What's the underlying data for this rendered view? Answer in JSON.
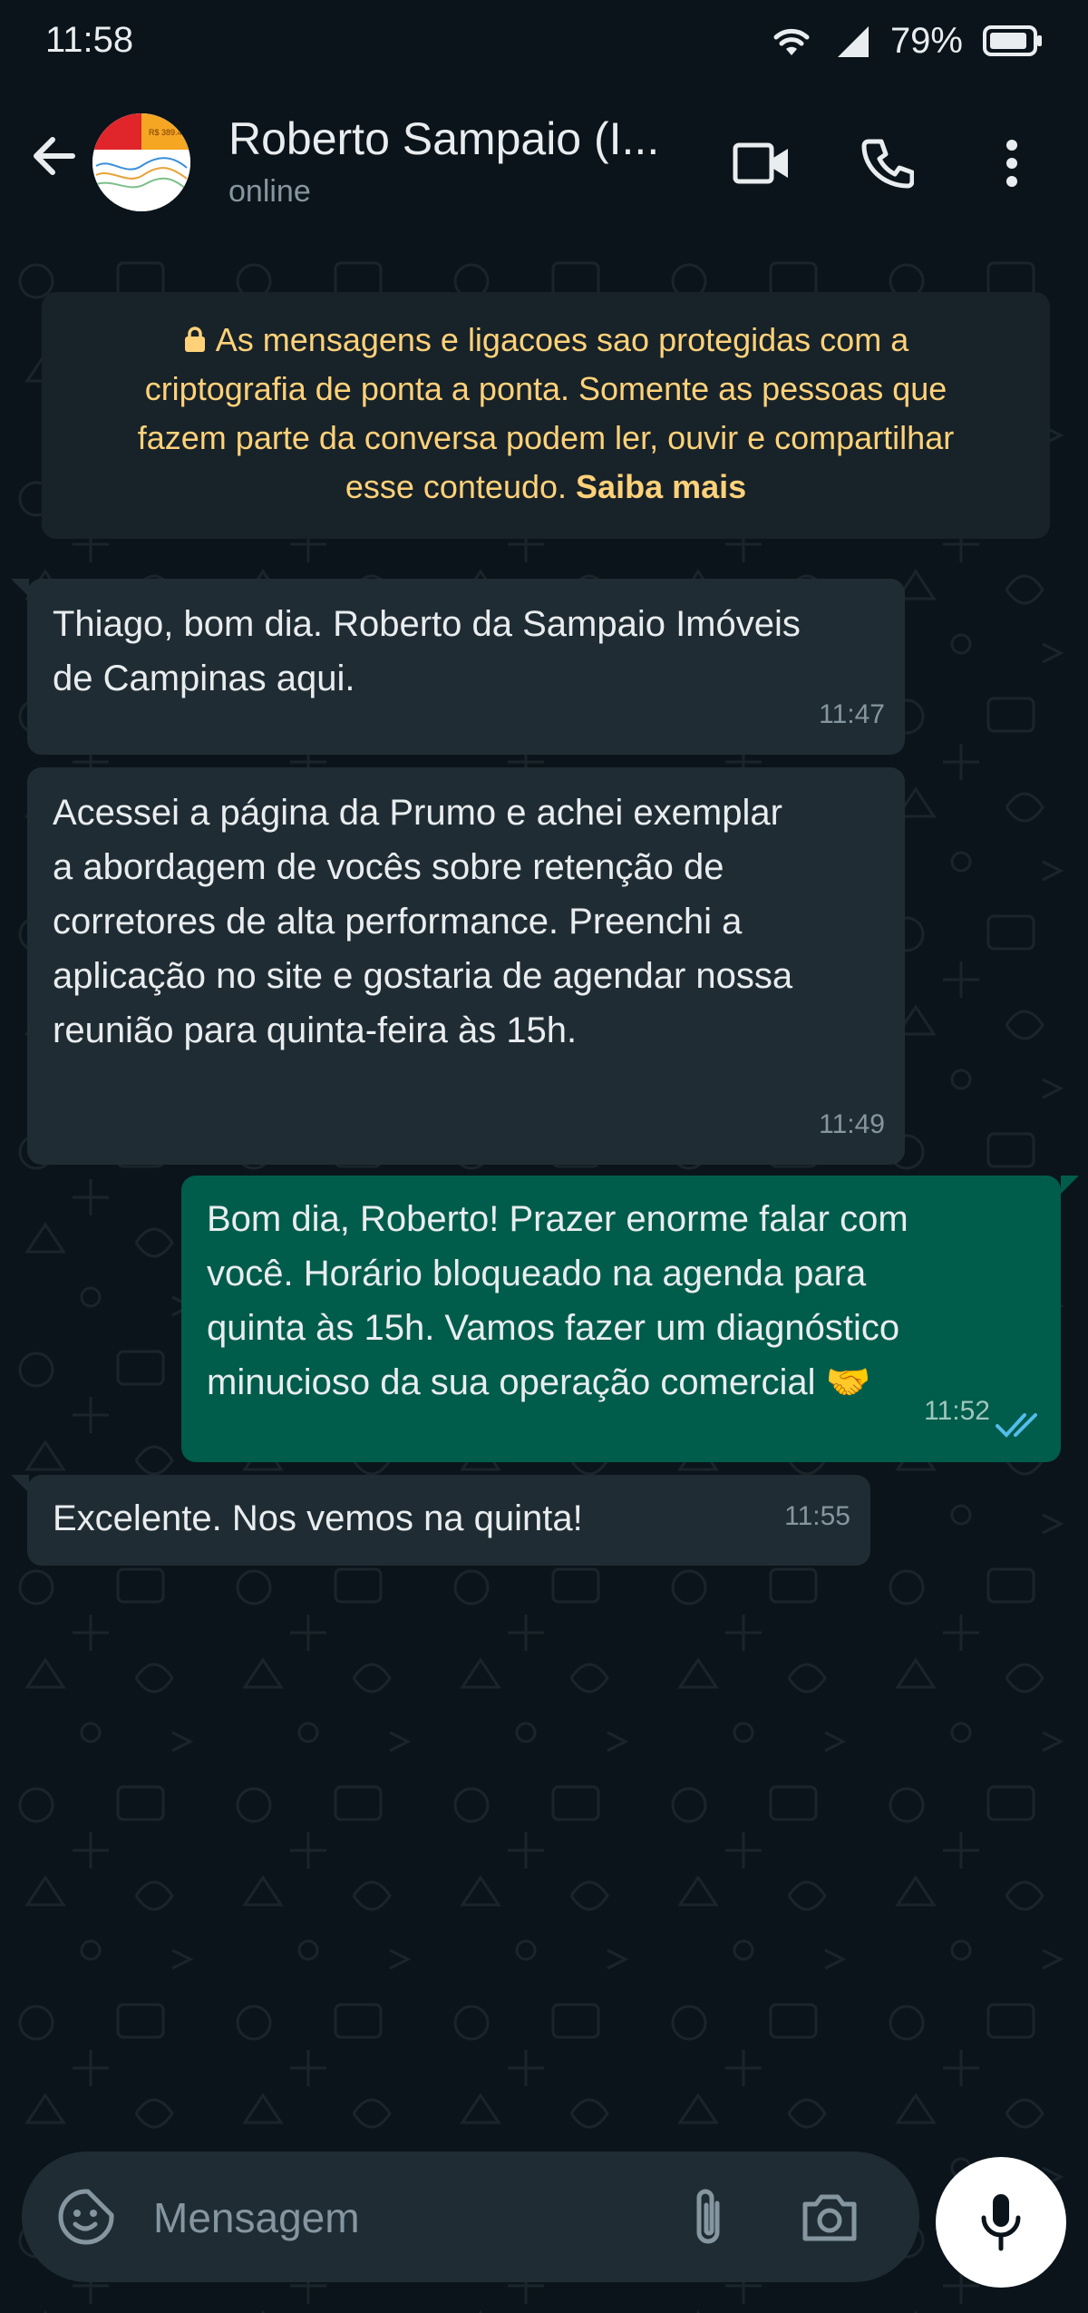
{
  "status_bar": {
    "time": "11:58",
    "battery": "79%"
  },
  "header": {
    "contact_name": "Roberto Sampaio (I...",
    "contact_status": "online",
    "avatar_text": "R$ 389.4..."
  },
  "encryption": {
    "line1": "As mensagens e ligacoes sao protegidas com a",
    "line2": "criptografia de ponta a ponta. Somente as pessoas que",
    "line3": "fazem parte da conversa podem ler, ouvir e compartilhar",
    "line4_prefix": "esse conteudo.",
    "link": "Saiba mais"
  },
  "messages": [
    {
      "direction": "in",
      "text": "Thiago, bom dia. Roberto da Sampaio Imóveis\nde Campinas aqui.",
      "time": "11:47"
    },
    {
      "direction": "in",
      "text": "Acessei a página da Prumo e achei exemplar\na abordagem de vocês sobre retenção de\ncorretores de alta performance. Preenchi a\naplicação no site e gostaria de agendar nossa\nreunião para quinta-feira às 15h.",
      "time": "11:49"
    },
    {
      "direction": "out",
      "text": "Bom dia, Roberto! Prazer enorme falar com\nvocê. Horário bloqueado na agenda para\nquinta às 15h. Vamos fazer um diagnóstico\nminucioso da sua operação comercial 🤝",
      "time": "11:52",
      "status": "read"
    },
    {
      "direction": "in",
      "text": "Excelente. Nos vemos na quinta!",
      "time": "11:55"
    }
  ],
  "input": {
    "placeholder": "Mensagem"
  },
  "colors": {
    "background": "#0b141a",
    "incoming": "#202c33",
    "outgoing": "#005c4b",
    "notice": "#ffd279",
    "read_ticks": "#53bdeb"
  }
}
